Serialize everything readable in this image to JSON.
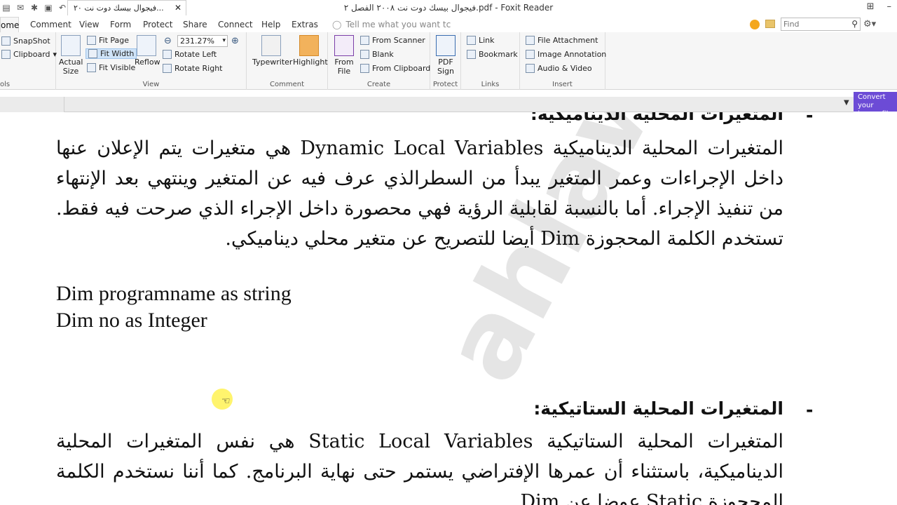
{
  "titlebar": {
    "title": "فيجوال بيسك دوت نت ٢٠٠٨ الفصل ٢.pdf - Foxit Reader"
  },
  "menu": {
    "items": [
      "ome",
      "Comment",
      "View",
      "Form",
      "Protect",
      "Share",
      "Connect",
      "Help",
      "Extras"
    ],
    "tell_me": "Tell me what you want tc",
    "find_placeholder": "Find"
  },
  "ribbon": {
    "tools": {
      "snapshot": "SnapShot",
      "clipboard": "Clipboard",
      "label": "ols"
    },
    "view": {
      "actual_size": "Actual Size",
      "fit_page": "Fit Page",
      "fit_width": "Fit Width",
      "fit_visible": "Fit Visible",
      "reflow": "Reflow",
      "zoom": "231.27%",
      "rotate_left": "Rotate Left",
      "rotate_right": "Rotate Right",
      "label": "View"
    },
    "comment": {
      "typewriter": "Typewriter",
      "highlight": "Highlight",
      "label": "Comment"
    },
    "create": {
      "from_file": "From File",
      "from_scanner": "From Scanner",
      "blank": "Blank",
      "from_clipboard": "From Clipboard",
      "label": "Create"
    },
    "protect": {
      "pdf_sign": "PDF Sign",
      "label": "Protect"
    },
    "links": {
      "link": "Link",
      "bookmark": "Bookmark",
      "label": "Links"
    },
    "insert": {
      "file_attachment": "File Attachment",
      "image_annotation": "Image Annotation",
      "audio_video": "Audio & Video",
      "label": "Insert"
    }
  },
  "convert_badge": "Convert your image files",
  "tab": {
    "label": "فيجوال بيسك دوت نت ٢٠..."
  },
  "document": {
    "heading1": "المتغيرات المحلية الديناميكية:",
    "para1": "المتغيرات المحلية الديناميكية Dynamic Local Variables هي متغيرات يتم الإعلان عنها داخل الإجراءات وعمر المتغير يبدأ من السطرالذي عرف فيه عن المتغير وينتهي بعد الإنتهاء من تنفيذ الإجراء. أما بالنسبة لقابلية الرؤية فهي محصورة داخل الإجراء الذي صرحت فيه فقط. تستخدم الكلمة المحجوزة Dim أيضا للتصريح عن متغير محلي ديناميكي.",
    "code1": "Dim programname as string",
    "code2": "Dim no as Integer",
    "heading2": "المتغيرات المحلية الستاتيكية:",
    "para2": "المتغيرات المحلية الستاتيكية Static Local Variables هي نفس المتغيرات المحلية الديناميكية، باستثناء أن عمرها الإفتراضي يستمر حتى نهاية البرنامج. كما أننا نستخدم الكلمة المحجوزة Static عوضا عن Dim",
    "bullet": "-",
    "watermark": "ahlawi"
  }
}
